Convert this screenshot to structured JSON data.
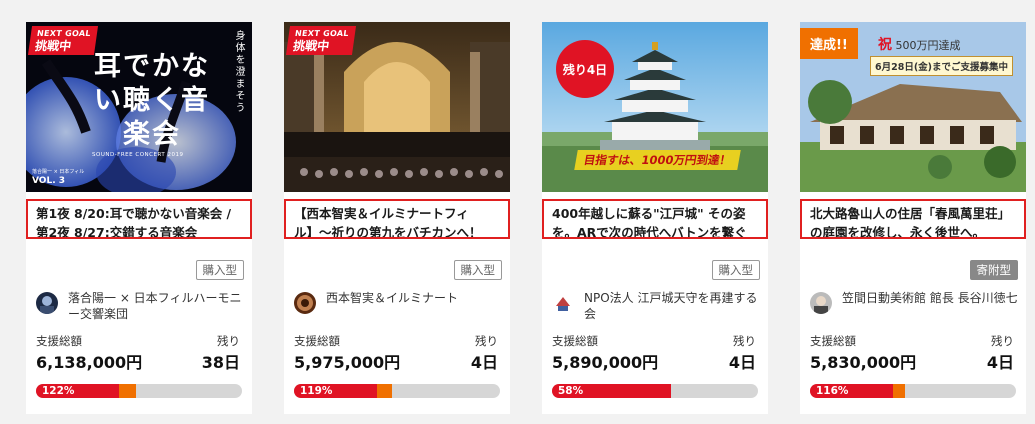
{
  "cards": [
    {
      "badge": {
        "line1": "NEXT GOAL",
        "line2": "挑戦中"
      },
      "image_text": {
        "main": "耳でかない聴く音楽会",
        "sub": "SOUND-FREE CONCERT 2019",
        "side": "身体を澄まそう",
        "vol": "VOL. 3",
        "credit": "落合陽一 × 日本フィル"
      },
      "title": "第1夜 8/20:耳で聴かない音楽会 / 第2夜 8/27:交錯する音楽会",
      "type": "購入型",
      "owner": "落合陽一 × 日本フィルハーモニー交響楽団",
      "support_label": "支援総額",
      "support_amount": "6,138,000円",
      "remaining_label": "残り",
      "remaining": "38日",
      "percent_label": "122%",
      "progress": 1.22
    },
    {
      "badge": {
        "line1": "NEXT GOAL",
        "line2": "挑戦中"
      },
      "title": "【西本智実＆イルミナートフィル】〜祈りの第九をバチカンへ！",
      "type": "購入型",
      "owner": "西本智実＆イルミナート",
      "support_label": "支援総額",
      "support_amount": "5,975,000円",
      "remaining_label": "残り",
      "remaining": "4日",
      "percent_label": "119%",
      "progress": 1.19
    },
    {
      "badge": {
        "circle": "残り4日"
      },
      "image_text": {
        "banner": "目指すは、1000万円到達！"
      },
      "title": "400年越しに蘇る\"江戸城\" その姿を。ARで次の時代へバトンを繋ぐ",
      "type": "購入型",
      "owner": "NPO法人 江戸城天守を再建する会",
      "support_label": "支援総額",
      "support_amount": "5,890,000円",
      "remaining_label": "残り",
      "remaining": "4日",
      "percent_label": "58%",
      "progress": 0.58
    },
    {
      "badge": {
        "achieved": "達成!!"
      },
      "image_text": {
        "celebrate_char": "祝",
        "celebrate": "500万円達成",
        "date": "6月28日(金)までご支援募集中"
      },
      "title": "北大路魯山人の住居「春風萬里荘」の庭園を改修し、永く後世へ。",
      "type": "寄附型",
      "owner": "笠間日動美術館 館長 長谷川徳七",
      "support_label": "支援総額",
      "support_amount": "5,830,000円",
      "remaining_label": "残り",
      "remaining": "4日",
      "percent_label": "116%",
      "progress": 1.16
    }
  ],
  "colors": {
    "red": "#e01324",
    "orange": "#f07000",
    "bar_bg": "#d6d6d6",
    "highlight": "#e02020"
  }
}
